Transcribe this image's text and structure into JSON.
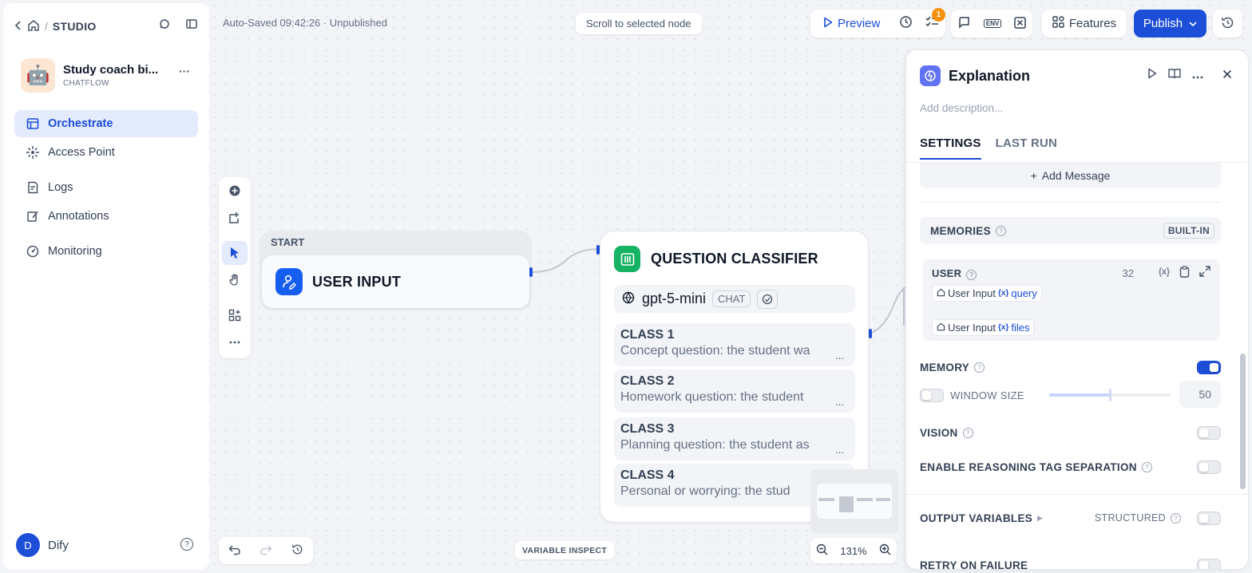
{
  "sidebar": {
    "breadcrumb_separator": "/",
    "breadcrumb_label": "STUDIO",
    "app_name": "Study coach bi...",
    "app_mode": "CHATFLOW",
    "app_avatar_emoji": "🤖",
    "nav": [
      {
        "label": "Orchestrate",
        "icon": "layout-icon",
        "active": true
      },
      {
        "label": "Access Point",
        "icon": "access-point-icon",
        "active": false
      },
      {
        "label": "Logs",
        "icon": "logs-icon",
        "active": false
      },
      {
        "label": "Annotations",
        "icon": "annotations-icon",
        "active": false
      },
      {
        "label": "Monitoring",
        "icon": "monitoring-icon",
        "active": false
      }
    ],
    "user_initial": "D",
    "user_name": "Dify"
  },
  "header": {
    "autosave": "Auto-Saved 09:42:26 · Unpublished",
    "scroll_to_selected": "Scroll to selected node",
    "preview_label": "Preview",
    "checklist_badge": "1",
    "env_label": "ENV",
    "features_label": "Features",
    "publish_label": "Publish"
  },
  "canvas": {
    "start_label": "START",
    "user_input_title": "USER INPUT",
    "classifier_title": "QUESTION CLASSIFIER",
    "model_name": "gpt-5-mini",
    "model_tag": "CHAT",
    "classes": [
      {
        "name": "CLASS 1",
        "desc": "Concept question: the student wa"
      },
      {
        "name": "CLASS 2",
        "desc": "Homework question: the student "
      },
      {
        "name": "CLASS 3",
        "desc": "Planning question: the student as"
      },
      {
        "name": "CLASS 4",
        "desc": "Personal or worrying: the stud"
      }
    ],
    "class_more": "...",
    "zoom_level": "131%",
    "variable_inspect": "VARIABLE INSPECT"
  },
  "panel": {
    "title": "Explanation",
    "description_placeholder": "Add description...",
    "tabs": [
      "SETTINGS",
      "LAST RUN"
    ],
    "add_message": "Add Message",
    "memories_label": "MEMORIES",
    "builtin_label": "BUILT-IN",
    "user_label": "USER",
    "user_count": "32",
    "var_chips": [
      {
        "node": "User Input",
        "var": "query"
      },
      {
        "node": "User Input",
        "var": "files"
      }
    ],
    "memory_label": "MEMORY",
    "memory_on": true,
    "window_size_label": "WINDOW SIZE",
    "window_size_value": "50",
    "window_size_fraction": 0.5,
    "vision_label": "VISION",
    "reasoning_label": "ENABLE REASONING TAG SEPARATION",
    "output_variables_label": "OUTPUT VARIABLES",
    "structured_label": "STRUCTURED",
    "retry_label": "RETRY ON FAILURE"
  },
  "colors": {
    "accent": "#1d4ed8",
    "classifier_green": "#16b364",
    "badge_orange": "#f79009",
    "panel_icon": "#6172f3"
  }
}
